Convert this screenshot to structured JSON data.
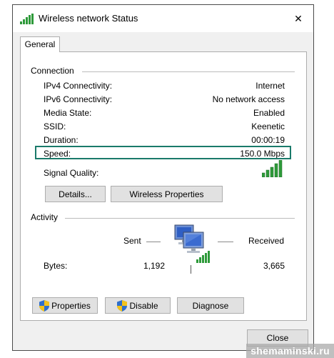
{
  "window": {
    "title": "Wireless network Status",
    "close_glyph": "✕"
  },
  "tabs": [
    {
      "label": "General"
    }
  ],
  "connection": {
    "label": "Connection",
    "rows": [
      {
        "label": "IPv4 Connectivity:",
        "value": "Internet"
      },
      {
        "label": "IPv6 Connectivity:",
        "value": "No network access"
      },
      {
        "label": "Media State:",
        "value": "Enabled"
      },
      {
        "label": "SSID:",
        "value": "Keenetic"
      },
      {
        "label": "Duration:",
        "value": "00:00:19"
      },
      {
        "label": "Speed:",
        "value": "150.0 Mbps"
      }
    ],
    "signal_quality_label": "Signal Quality:",
    "signal_bars": 5,
    "details_button": "Details...",
    "wireless_properties_button": "Wireless Properties"
  },
  "activity": {
    "label": "Activity",
    "sent_label": "Sent",
    "received_label": "Received",
    "bytes_label": "Bytes:",
    "bytes_sent": "1,192",
    "bytes_received": "3,665",
    "network_icon": "network-computers-icon"
  },
  "buttons": {
    "properties": "Properties",
    "disable": "Disable",
    "diagnose": "Diagnose",
    "close": "Close"
  },
  "watermark": "shemaminski.ru",
  "colors": {
    "highlight_border": "#1a7a6a",
    "signal_green": "#2e9a3a",
    "shield_blue": "#2f6fcc",
    "shield_yellow": "#f2c21b"
  }
}
